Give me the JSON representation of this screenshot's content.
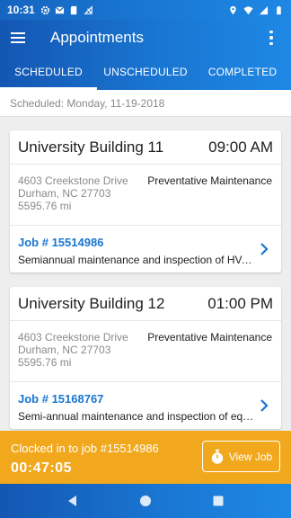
{
  "status_bar": {
    "time": "10:31",
    "left_icons": [
      "gear-icon",
      "gmail-icon",
      "sd-card-icon",
      "no-signal-icon"
    ],
    "right_icons": [
      "location-icon",
      "wifi-icon",
      "signal-icon",
      "battery-icon"
    ]
  },
  "app_bar": {
    "title": "Appointments"
  },
  "tabs": [
    {
      "label": "SCHEDULED",
      "active": true
    },
    {
      "label": "UNSCHEDULED",
      "active": false
    },
    {
      "label": "COMPLETED",
      "active": false
    }
  ],
  "subheader": "Scheduled: Monday, 11-19-2018",
  "appointments": [
    {
      "building": "University Building 11",
      "time": "09:00 AM",
      "address_line1": "4603 Creekstone Drive",
      "address_line2": "Durham, NC 27703",
      "distance": "5595.76 mi",
      "maintenance_type": "Preventative Maintenance",
      "job_number": "Job # 15514986",
      "description": "Semiannual maintenance and inspection of HVAC system and filters"
    },
    {
      "building": "University Building 12",
      "time": "01:00 PM",
      "address_line1": "4603 Creekstone Drive",
      "address_line2": "Durham, NC 27703",
      "distance": "5595.76 mi",
      "maintenance_type": "Preventative Maintenance",
      "job_number": "Job # 15168767",
      "description": "Semi-annual maintenance and inspection of equipment"
    }
  ],
  "clock_bar": {
    "text": "Clocked in to job #15514986",
    "timer": "00:47:05",
    "button_label": "View Job"
  },
  "colors": {
    "primary": "#1976d2",
    "accent": "#f2a81d",
    "link": "#1976d2"
  }
}
